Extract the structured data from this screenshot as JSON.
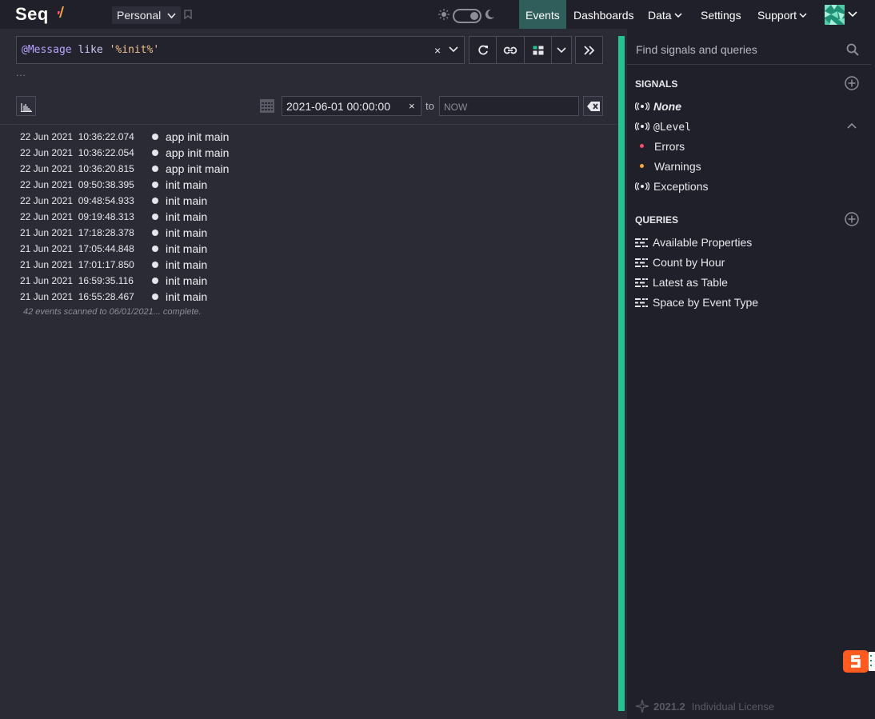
{
  "app": {
    "logo": "Seq"
  },
  "workspace": {
    "label": "Personal"
  },
  "nav": {
    "events": "Events",
    "dashboards": "Dashboards",
    "data": "Data",
    "settings": "Settings",
    "support": "Support"
  },
  "query": {
    "prop": "@Message",
    "op": "like",
    "value": "'%init%'",
    "clear": "×",
    "more": "..."
  },
  "range": {
    "from": "2021-06-01 00:00:00",
    "from_clear": "×",
    "to_label": "to",
    "to_placeholder": "NOW"
  },
  "events": [
    {
      "date": "22 Jun 2021",
      "time": "10:36:22.074",
      "message": "app init main"
    },
    {
      "date": "22 Jun 2021",
      "time": "10:36:22.054",
      "message": "app init main"
    },
    {
      "date": "22 Jun 2021",
      "time": "10:36:20.815",
      "message": "app init main"
    },
    {
      "date": "22 Jun 2021",
      "time": "09:50:38.395",
      "message": "init main"
    },
    {
      "date": "22 Jun 2021",
      "time": "09:48:54.933",
      "message": "init main"
    },
    {
      "date": "22 Jun 2021",
      "time": "09:19:48.313",
      "message": "init main"
    },
    {
      "date": "21 Jun 2021",
      "time": "17:18:28.378",
      "message": "init main"
    },
    {
      "date": "21 Jun 2021",
      "time": "17:05:44.848",
      "message": "init main"
    },
    {
      "date": "21 Jun 2021",
      "time": "17:01:17.850",
      "message": "init main"
    },
    {
      "date": "21 Jun 2021",
      "time": "16:59:35.116",
      "message": "init main"
    },
    {
      "date": "21 Jun 2021",
      "time": "16:55:28.467",
      "message": "init main"
    }
  ],
  "status": "42 events scanned to 06/01/2021... complete.",
  "panel": {
    "search_placeholder": "Find signals and queries",
    "signals_title": "SIGNALS",
    "signals": {
      "none": "None",
      "level": "@Level",
      "errors": "Errors",
      "warnings": "Warnings",
      "exceptions": "Exceptions"
    },
    "queries_title": "QUERIES",
    "queries": [
      "Available Properties",
      "Count by Hour",
      "Latest as Table",
      "Space by Event Type"
    ],
    "version": "2021.2",
    "license": "Individual License"
  },
  "colors": {
    "accent": "#23c290",
    "active_nav": "#2f5e5b",
    "error": "#f0506e",
    "warning": "#f5a442"
  },
  "icons": [
    "seq-flame-icon",
    "pin-icon",
    "sun-icon",
    "moon-icon",
    "chevron-down-icon",
    "refresh-icon",
    "link-icon",
    "layout-icon",
    "expand-panel-icon",
    "histogram-icon",
    "calendar-icon",
    "clear-range-icon",
    "search-icon",
    "add-signal-icon",
    "broadcast-icon",
    "collapse-icon",
    "add-query-icon",
    "query-icon",
    "seq-spark-icon"
  ]
}
